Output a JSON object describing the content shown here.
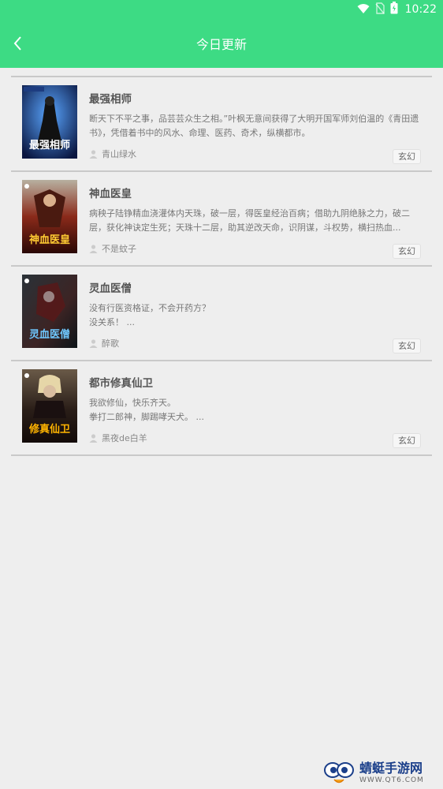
{
  "status_bar": {
    "time": "10:22"
  },
  "header": {
    "title": "今日更新"
  },
  "books": [
    {
      "title": "最强相师",
      "description": "断天下不平之事，品芸芸众生之相。”叶枫无意间获得了大明开国军师刘伯温的《青田遗书》，凭借着书中的风水、命理、医药、奇术，纵横都市。",
      "author": "青山绿水",
      "tag": "玄幻",
      "cover_text": "最强相师"
    },
    {
      "title": "神血医皇",
      "description": "病秧子陆铮精血浇灌体内天珠，破一层，得医皇经治百病；借助九阴绝脉之力，破二层，获化神诀定生死；天珠十二层，助其逆改天命，识阴谋，斗权势，横扫热血...",
      "author": "不是蚊子",
      "tag": "玄幻",
      "cover_text": "神血医皇"
    },
    {
      "title": "灵血医僧",
      "description": "没有行医资格证，不会开药方？\n没关系！ ...",
      "author": "醉歌",
      "tag": "玄幻",
      "cover_text": "灵血医僧"
    },
    {
      "title": "都市修真仙卫",
      "description": "我欲修仙，快乐齐天。\n拳打二郎神，脚踢哮天犬。 ...",
      "author": "黑夜de白羊",
      "tag": "玄幻",
      "cover_text": "修真仙卫"
    }
  ],
  "watermark": {
    "name": "蜻蜓手游网",
    "url": "WWW.QT6.COM"
  },
  "colors": {
    "accent": "#3ddb84"
  }
}
